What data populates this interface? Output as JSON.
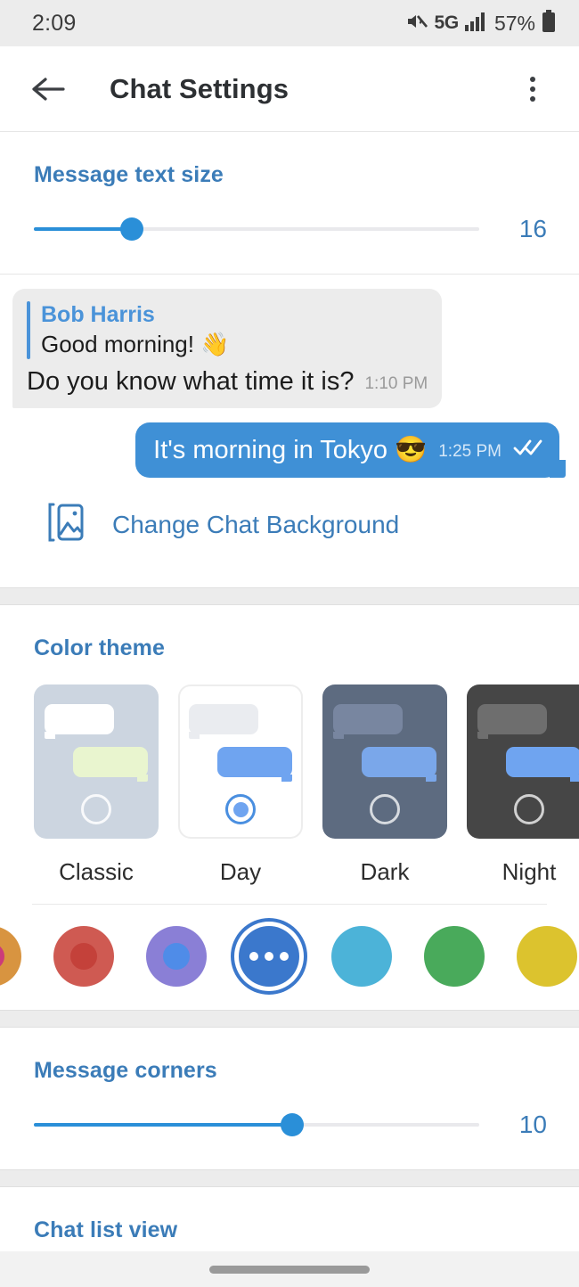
{
  "status_bar": {
    "time": "2:09",
    "network": "5G",
    "battery_percent": "57%",
    "icons": [
      "mute-icon",
      "signal-bars-icon",
      "battery-icon"
    ]
  },
  "app_bar": {
    "back_icon": "back-arrow-icon",
    "title": "Chat Settings",
    "overflow_icon": "overflow-menu-icon"
  },
  "text_size": {
    "title": "Message text size",
    "value": "16",
    "thumb_percent": 22
  },
  "chat_preview": {
    "incoming": {
      "quote_name": "Bob Harris",
      "quote_text": "Good morning! 👋",
      "text": "Do you know what time it is?",
      "time": "1:10 PM"
    },
    "outgoing": {
      "text": "It's morning in Tokyo 😎",
      "time": "1:25 PM",
      "status_icon": "double-check-icon"
    }
  },
  "change_background": {
    "icon": "image-placeholder-icon",
    "label": "Change Chat Background"
  },
  "color_theme": {
    "title": "Color theme",
    "themes": [
      {
        "name": "Classic",
        "selected": false,
        "card_bg": "#ccd5e0",
        "border": "transparent",
        "bubble_in": "#ffffff",
        "bubble_out": "#e9f5cf",
        "radio_light": true
      },
      {
        "name": "Day",
        "selected": true,
        "card_bg": "#ffffff",
        "border": "#ededed",
        "bubble_in": "#eaecf0",
        "bubble_out": "#6fa4f0",
        "radio_light": false
      },
      {
        "name": "Dark",
        "selected": false,
        "card_bg": "#5d6b80",
        "border": "transparent",
        "bubble_in": "#7886a0",
        "bubble_out": "#7aa7ea",
        "radio_light": true
      },
      {
        "name": "Night",
        "selected": false,
        "card_bg": "#464646",
        "border": "transparent",
        "bubble_in": "#6e6e6e",
        "bubble_out": "#6fa4f0",
        "radio_light": true
      }
    ],
    "swatches": [
      {
        "name": "orange",
        "color": "#d89440",
        "inner": "#cc3b7a",
        "selected": false
      },
      {
        "name": "red",
        "color": "#cf5a52",
        "inner": "#c4413a",
        "selected": false
      },
      {
        "name": "purple",
        "color": "#8a7fd6",
        "inner": "#4f8ce8",
        "selected": false
      },
      {
        "name": "blue",
        "color": "#3b78cc",
        "inner": "",
        "selected": true
      },
      {
        "name": "cyan",
        "color": "#4cb3d8",
        "inner": "",
        "selected": false
      },
      {
        "name": "green",
        "color": "#49aa5b",
        "inner": "",
        "selected": false
      },
      {
        "name": "yellow",
        "color": "#dcc32e",
        "inner": "",
        "selected": false
      }
    ]
  },
  "message_corners": {
    "title": "Message corners",
    "value": "10",
    "thumb_percent": 58
  },
  "chat_list_view": {
    "title": "Chat list view"
  },
  "accent_color": "#2a8fd8",
  "link_color": "#3b7cb8"
}
